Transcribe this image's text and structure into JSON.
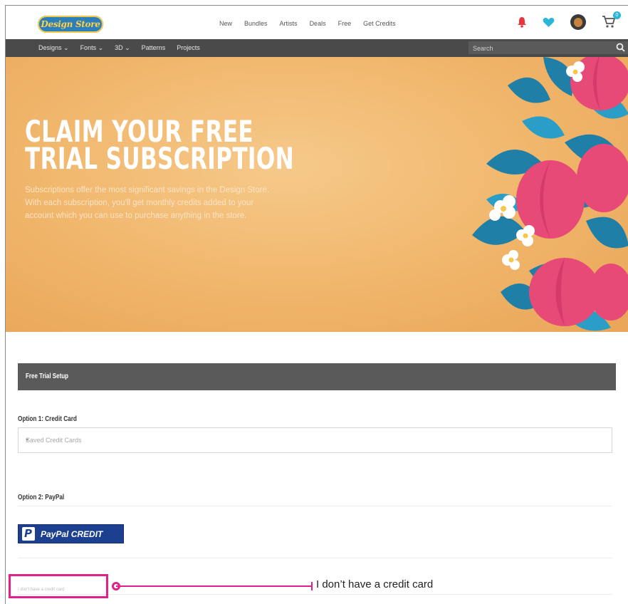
{
  "header": {
    "logo_text": "Design Store",
    "nav_links": [
      "New",
      "Bundles",
      "Artists",
      "Deals",
      "Free",
      "Get Credits"
    ],
    "cart_count": "0"
  },
  "navbar": {
    "items": [
      "Designs ⌄",
      "Fonts ⌄",
      "3D ⌄",
      "Patterns",
      "Projects"
    ],
    "search_placeholder": "Search"
  },
  "hero": {
    "title_line1": "CLAIM YOUR FREE",
    "title_line2": "TRIAL SUBSCRIPTION",
    "body": "Subscriptions offer the most significant savings in the Design Store. With each subscription, you'll get monthly credits added to your account which you can use to purchase anything in the store."
  },
  "setup": {
    "section_title": "Free Trial Setup",
    "option1_label": "Option 1: Credit Card",
    "card_select_value": "Saved Credit Cards",
    "option2_label": "Option 2: PayPal",
    "paypal_text": "PayPal CREDIT",
    "no_card_link": "I don't have a credit card"
  },
  "annotation": {
    "text": "I don’t have a credit card"
  },
  "colors": {
    "accent_pink": "#e0218a",
    "nav_dark": "#4a4a4a",
    "hero_orange": "#f0b56a",
    "paypal_blue": "#1c3f8f"
  }
}
